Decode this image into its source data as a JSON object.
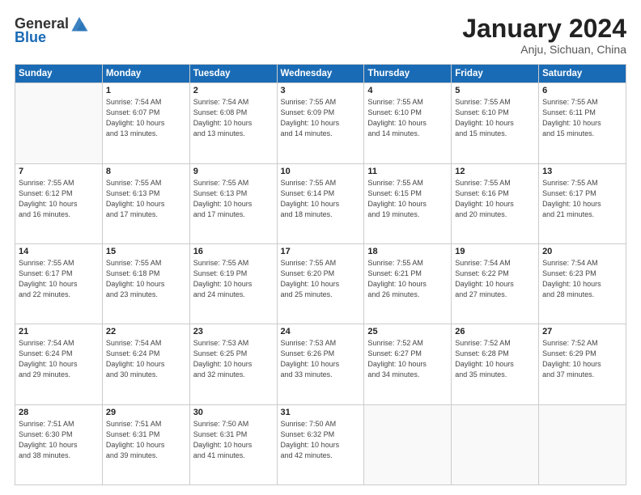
{
  "header": {
    "logo_general": "General",
    "logo_blue": "Blue",
    "title": "January 2024",
    "location": "Anju, Sichuan, China"
  },
  "weekdays": [
    "Sunday",
    "Monday",
    "Tuesday",
    "Wednesday",
    "Thursday",
    "Friday",
    "Saturday"
  ],
  "weeks": [
    [
      {
        "day": "",
        "info": ""
      },
      {
        "day": "1",
        "info": "Sunrise: 7:54 AM\nSunset: 6:07 PM\nDaylight: 10 hours\nand 13 minutes."
      },
      {
        "day": "2",
        "info": "Sunrise: 7:54 AM\nSunset: 6:08 PM\nDaylight: 10 hours\nand 13 minutes."
      },
      {
        "day": "3",
        "info": "Sunrise: 7:55 AM\nSunset: 6:09 PM\nDaylight: 10 hours\nand 14 minutes."
      },
      {
        "day": "4",
        "info": "Sunrise: 7:55 AM\nSunset: 6:10 PM\nDaylight: 10 hours\nand 14 minutes."
      },
      {
        "day": "5",
        "info": "Sunrise: 7:55 AM\nSunset: 6:10 PM\nDaylight: 10 hours\nand 15 minutes."
      },
      {
        "day": "6",
        "info": "Sunrise: 7:55 AM\nSunset: 6:11 PM\nDaylight: 10 hours\nand 15 minutes."
      }
    ],
    [
      {
        "day": "7",
        "info": "Sunrise: 7:55 AM\nSunset: 6:12 PM\nDaylight: 10 hours\nand 16 minutes."
      },
      {
        "day": "8",
        "info": "Sunrise: 7:55 AM\nSunset: 6:13 PM\nDaylight: 10 hours\nand 17 minutes."
      },
      {
        "day": "9",
        "info": "Sunrise: 7:55 AM\nSunset: 6:13 PM\nDaylight: 10 hours\nand 17 minutes."
      },
      {
        "day": "10",
        "info": "Sunrise: 7:55 AM\nSunset: 6:14 PM\nDaylight: 10 hours\nand 18 minutes."
      },
      {
        "day": "11",
        "info": "Sunrise: 7:55 AM\nSunset: 6:15 PM\nDaylight: 10 hours\nand 19 minutes."
      },
      {
        "day": "12",
        "info": "Sunrise: 7:55 AM\nSunset: 6:16 PM\nDaylight: 10 hours\nand 20 minutes."
      },
      {
        "day": "13",
        "info": "Sunrise: 7:55 AM\nSunset: 6:17 PM\nDaylight: 10 hours\nand 21 minutes."
      }
    ],
    [
      {
        "day": "14",
        "info": "Sunrise: 7:55 AM\nSunset: 6:17 PM\nDaylight: 10 hours\nand 22 minutes."
      },
      {
        "day": "15",
        "info": "Sunrise: 7:55 AM\nSunset: 6:18 PM\nDaylight: 10 hours\nand 23 minutes."
      },
      {
        "day": "16",
        "info": "Sunrise: 7:55 AM\nSunset: 6:19 PM\nDaylight: 10 hours\nand 24 minutes."
      },
      {
        "day": "17",
        "info": "Sunrise: 7:55 AM\nSunset: 6:20 PM\nDaylight: 10 hours\nand 25 minutes."
      },
      {
        "day": "18",
        "info": "Sunrise: 7:55 AM\nSunset: 6:21 PM\nDaylight: 10 hours\nand 26 minutes."
      },
      {
        "day": "19",
        "info": "Sunrise: 7:54 AM\nSunset: 6:22 PM\nDaylight: 10 hours\nand 27 minutes."
      },
      {
        "day": "20",
        "info": "Sunrise: 7:54 AM\nSunset: 6:23 PM\nDaylight: 10 hours\nand 28 minutes."
      }
    ],
    [
      {
        "day": "21",
        "info": "Sunrise: 7:54 AM\nSunset: 6:24 PM\nDaylight: 10 hours\nand 29 minutes."
      },
      {
        "day": "22",
        "info": "Sunrise: 7:54 AM\nSunset: 6:24 PM\nDaylight: 10 hours\nand 30 minutes."
      },
      {
        "day": "23",
        "info": "Sunrise: 7:53 AM\nSunset: 6:25 PM\nDaylight: 10 hours\nand 32 minutes."
      },
      {
        "day": "24",
        "info": "Sunrise: 7:53 AM\nSunset: 6:26 PM\nDaylight: 10 hours\nand 33 minutes."
      },
      {
        "day": "25",
        "info": "Sunrise: 7:52 AM\nSunset: 6:27 PM\nDaylight: 10 hours\nand 34 minutes."
      },
      {
        "day": "26",
        "info": "Sunrise: 7:52 AM\nSunset: 6:28 PM\nDaylight: 10 hours\nand 35 minutes."
      },
      {
        "day": "27",
        "info": "Sunrise: 7:52 AM\nSunset: 6:29 PM\nDaylight: 10 hours\nand 37 minutes."
      }
    ],
    [
      {
        "day": "28",
        "info": "Sunrise: 7:51 AM\nSunset: 6:30 PM\nDaylight: 10 hours\nand 38 minutes."
      },
      {
        "day": "29",
        "info": "Sunrise: 7:51 AM\nSunset: 6:31 PM\nDaylight: 10 hours\nand 39 minutes."
      },
      {
        "day": "30",
        "info": "Sunrise: 7:50 AM\nSunset: 6:31 PM\nDaylight: 10 hours\nand 41 minutes."
      },
      {
        "day": "31",
        "info": "Sunrise: 7:50 AM\nSunset: 6:32 PM\nDaylight: 10 hours\nand 42 minutes."
      },
      {
        "day": "",
        "info": ""
      },
      {
        "day": "",
        "info": ""
      },
      {
        "day": "",
        "info": ""
      }
    ]
  ]
}
